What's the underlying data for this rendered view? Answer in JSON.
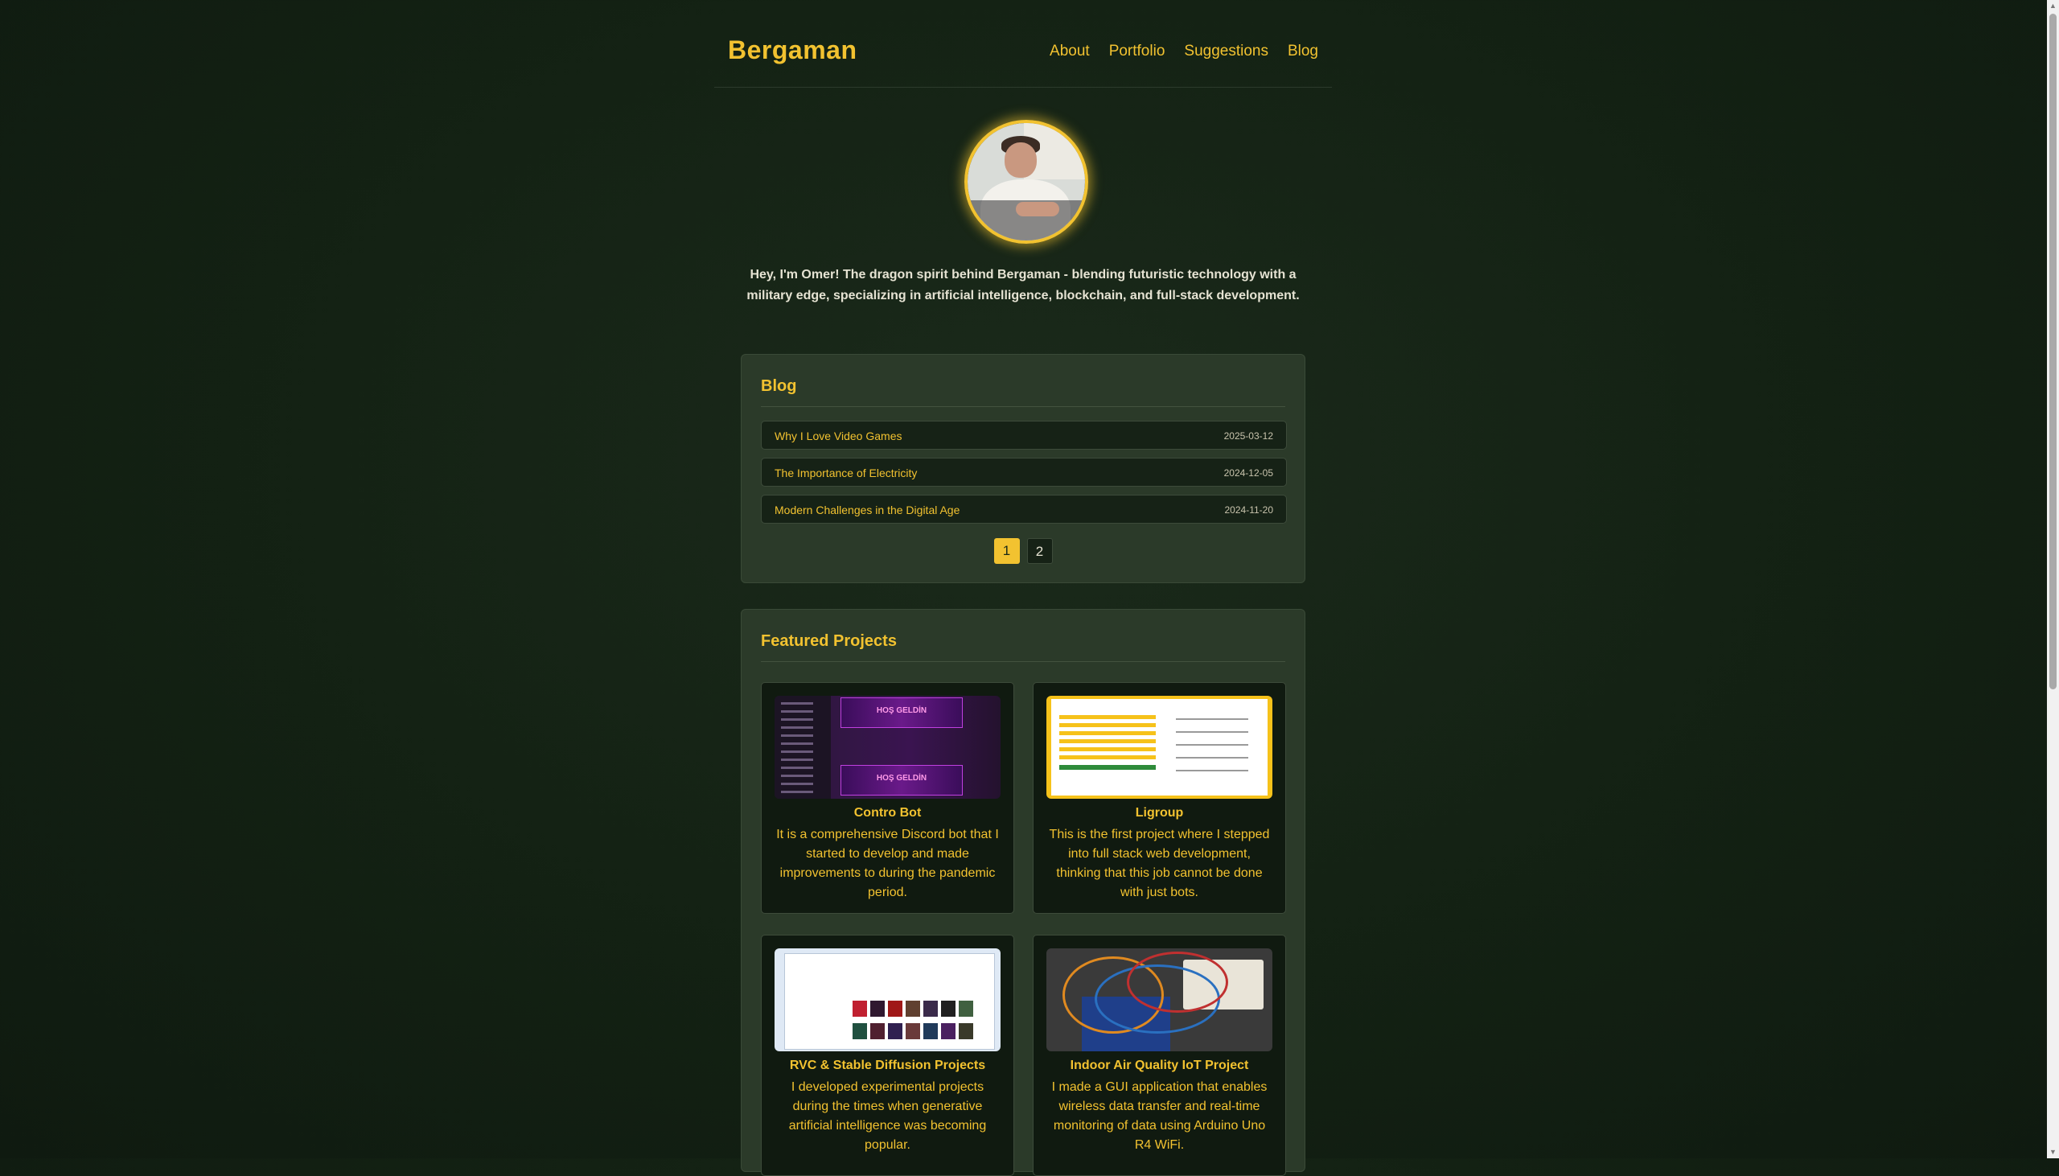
{
  "brand": "Bergaman",
  "nav": [
    "About",
    "Portfolio",
    "Suggestions",
    "Blog"
  ],
  "intro": "Hey, I'm Omer! The dragon spirit behind Bergaman - blending futuristic technology with a military edge, specializing in artificial intelligence, blockchain, and full-stack development.",
  "blog": {
    "title": "Blog",
    "posts": [
      {
        "title": "Why I Love Video Games",
        "date": "2025-03-12"
      },
      {
        "title": "The Importance of Electricity",
        "date": "2024-12-05"
      },
      {
        "title": "Modern Challenges in the Digital Age",
        "date": "2024-11-20"
      }
    ],
    "pages": [
      "1",
      "2"
    ],
    "current_page": "1"
  },
  "projects": {
    "title": "Featured Projects",
    "items": [
      {
        "name": "Contro Bot",
        "desc": "It is a comprehensive Discord bot that I started to develop and made improvements to during the pandemic period.",
        "banner_text": "HOŞ GELDİN"
      },
      {
        "name": "Ligroup",
        "desc": "This is the first project where I stepped into full stack web development, thinking that this job cannot be done with just bots."
      },
      {
        "name": "RVC & Stable Diffusion Projects",
        "desc": "I developed experimental projects during the times when generative artificial intelligence was becoming popular."
      },
      {
        "name": "Indoor Air Quality IoT Project",
        "desc": "I made a GUI application that enables wireless data transfer and real-time monitoring of data using Arduino Uno R4 WiFi."
      }
    ]
  },
  "colors": {
    "accent": "#f2c230",
    "background": "#132113",
    "card": "#2b3a29"
  }
}
